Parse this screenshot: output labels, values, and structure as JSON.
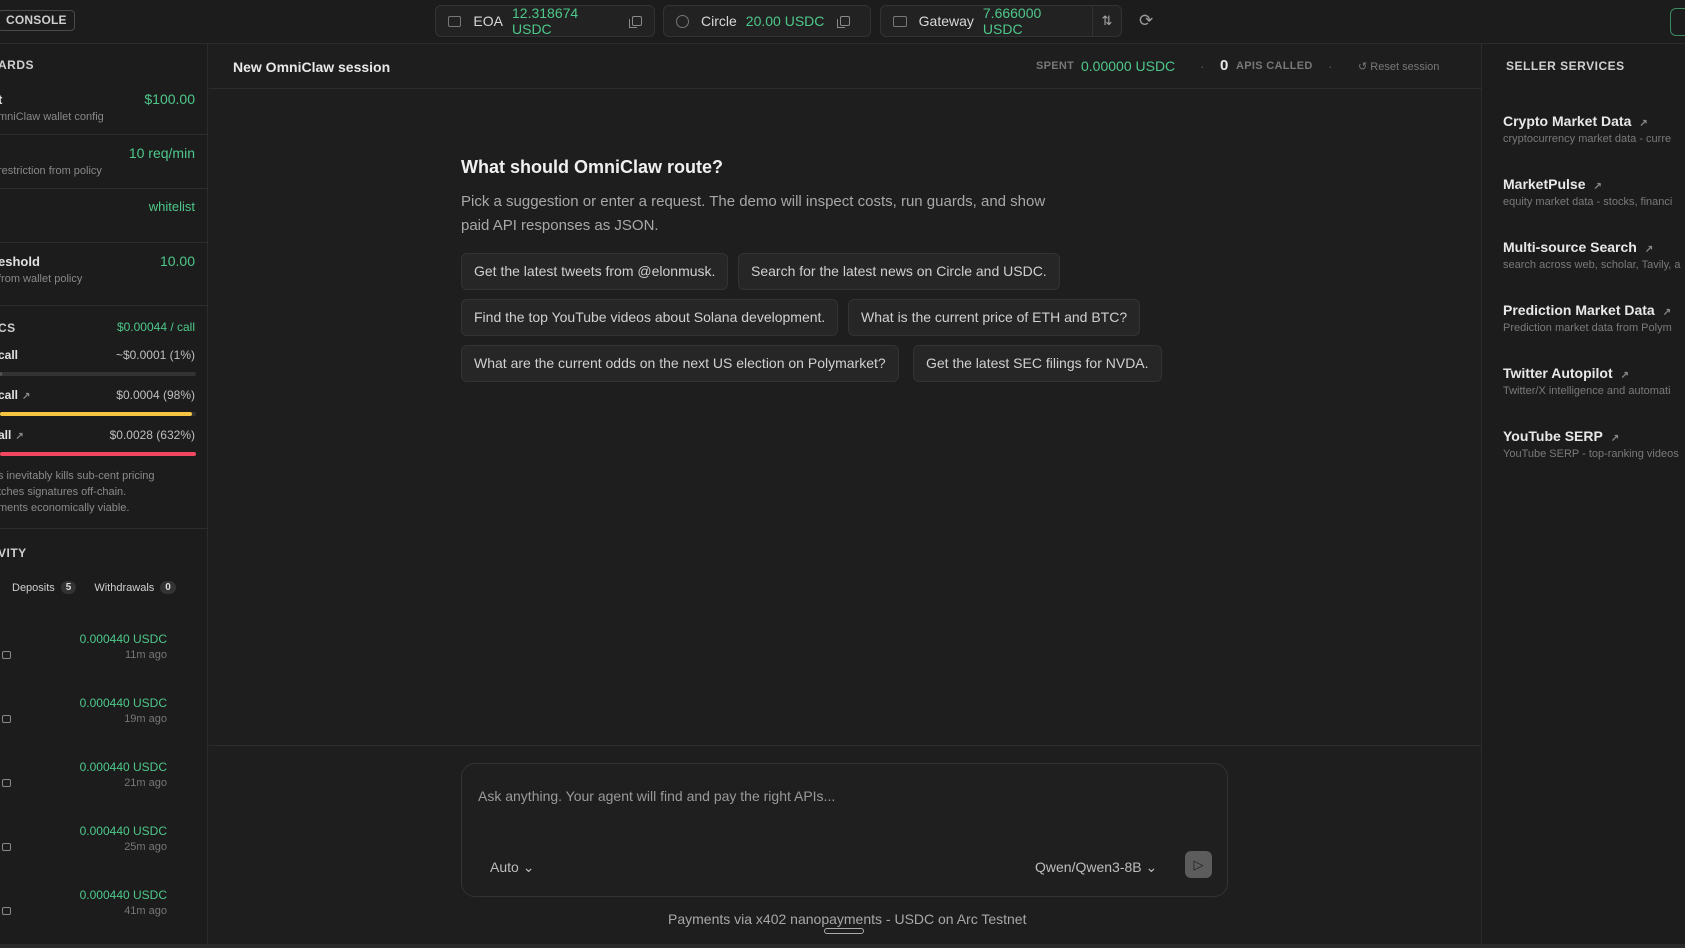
{
  "topbar": {
    "console": "CONSOLE",
    "wallets": [
      {
        "label": "EOA",
        "value": "12.318674 USDC"
      },
      {
        "label": "Circle",
        "value": "20.00 USDC"
      },
      {
        "label": "Gateway",
        "value": "7.666000 USDC"
      }
    ],
    "swap_icon": "⇅",
    "refresh_icon": "⟳"
  },
  "left": {
    "guards_heading": "ARDS",
    "guards": [
      {
        "title": "t",
        "sub": "mniClaw wallet config",
        "value": "$100.00"
      },
      {
        "title": "",
        "sub": "restriction from policy",
        "value": "10 req/min"
      },
      {
        "title": "",
        "sub": "",
        "value": "whitelist"
      },
      {
        "title": "eshold",
        "sub": "from wallet policy",
        "value": "10.00"
      }
    ],
    "economics_heading": "CS",
    "economics_value": "$0.00044 / call",
    "costs": [
      {
        "label": "call",
        "value": "~$0.0001 (1%)",
        "fill": 0.01,
        "color": "#555555"
      },
      {
        "label": "call",
        "value": "$0.0004 (98%)",
        "fill": 0.98,
        "color": "#f5c542"
      },
      {
        "label": "all",
        "value": "$0.0028 (632%)",
        "fill": 1.0,
        "color": "#f0465f"
      }
    ],
    "note_lines": [
      "s inevitably kills sub-cent pricing",
      "tches signatures off-chain.",
      "ments economically viable."
    ],
    "activity_heading": "VITY",
    "tabs": [
      {
        "label": "Deposits",
        "count": "5"
      },
      {
        "label": "Withdrawals",
        "count": "0"
      }
    ],
    "activity": [
      {
        "amount": "0.000440 USDC",
        "time": "11m ago"
      },
      {
        "amount": "0.000440 USDC",
        "time": "19m ago"
      },
      {
        "amount": "0.000440 USDC",
        "time": "21m ago"
      },
      {
        "amount": "0.000440 USDC",
        "time": "25m ago"
      },
      {
        "amount": "0.000440 USDC",
        "time": "41m ago"
      }
    ]
  },
  "main": {
    "session_title": "New OmniClaw session",
    "spent_label": "SPENT",
    "spent_value": "0.00000 USDC",
    "apis_count": "0",
    "apis_label": "APIS CALLED",
    "reset_label": "Reset session",
    "question": "What should OmniClaw route?",
    "description": "Pick a suggestion or enter a request. The demo will inspect costs, run guards, and show paid API responses as JSON.",
    "suggestions": [
      "Get the latest tweets from @elonmusk.",
      "Search for the latest news on Circle and USDC.",
      "Find the top YouTube videos about Solana development.",
      "What is the current price of ETH and BTC?",
      "What are the current odds on the next US election on Polymarket?",
      "Get the latest SEC filings for NVDA."
    ],
    "composer_placeholder": "Ask anything. Your agent will find and pay the right APIs...",
    "mode": "Auto",
    "model": "Qwen/Qwen3-8B",
    "footer": "Payments via x402 nanopayments - USDC on Arc Testnet"
  },
  "right": {
    "heading": "SELLER SERVICES",
    "services": [
      {
        "name": "Crypto Market Data",
        "desc": "cryptocurrency market data - curre"
      },
      {
        "name": "MarketPulse",
        "desc": "equity market data - stocks, financi"
      },
      {
        "name": "Multi-source Search",
        "desc": "search across web, scholar, Tavily, a"
      },
      {
        "name": "Prediction Market Data",
        "desc": "Prediction market data from Polym"
      },
      {
        "name": "Twitter Autopilot",
        "desc": "Twitter/X intelligence and automati"
      },
      {
        "name": "YouTube SERP",
        "desc": "YouTube SERP - top-ranking videos"
      }
    ]
  }
}
